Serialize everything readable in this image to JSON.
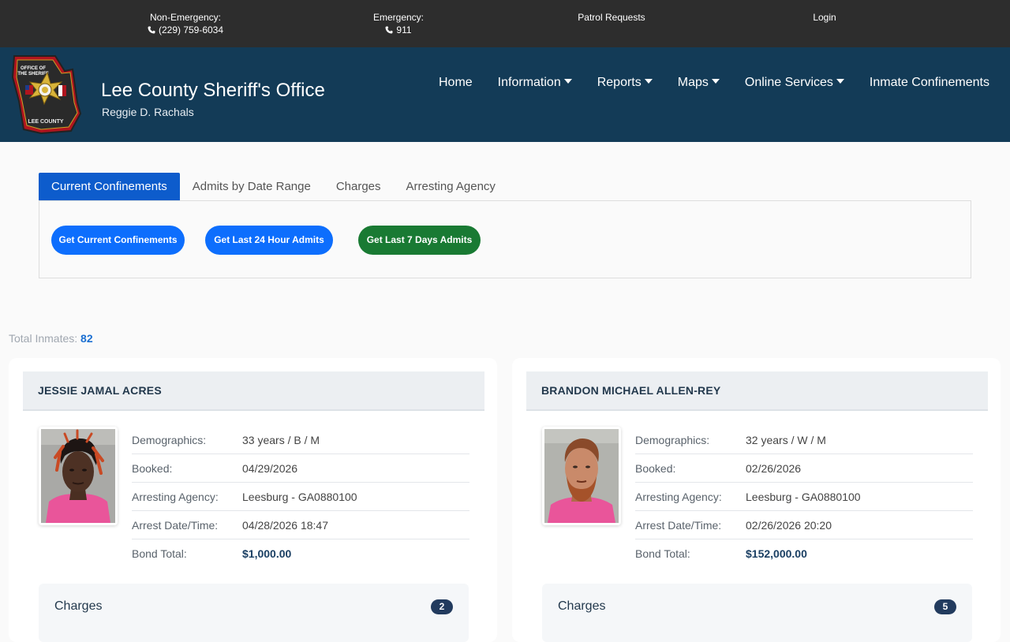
{
  "topbar": {
    "non_emergency_label": "Non-Emergency:",
    "non_emergency_phone": "(229) 759-6034",
    "emergency_label": "Emergency:",
    "emergency_phone": "911",
    "patrol_requests": "Patrol Requests",
    "login": "Login"
  },
  "header": {
    "title": "Lee County Sheriff's Office",
    "subtitle": "Reggie D. Rachals",
    "logo_text_top": "OFFICE OF THE SHERIFF",
    "logo_text_bottom": "LEE COUNTY",
    "logo_badge_text": "SHERIFF LEE COUNTY"
  },
  "nav": {
    "home": "Home",
    "information": "Information",
    "reports": "Reports",
    "maps": "Maps",
    "online_services": "Online Services",
    "inmate_confinements": "Inmate Confinements"
  },
  "tabs": {
    "current_confinements": "Current Confinements",
    "admits_by_date_range": "Admits by Date Range",
    "charges": "Charges",
    "arresting_agency": "Arresting Agency"
  },
  "buttons": {
    "get_current": "Get Current Confinements",
    "get_24h": "Get Last 24 Hour Admits",
    "get_7d": "Get Last 7 Days Admits"
  },
  "total": {
    "label": "Total Inmates:",
    "value": "82"
  },
  "labels": {
    "demographics": "Demographics:",
    "booked": "Booked:",
    "arresting_agency": "Arresting Agency:",
    "arrest_datetime": "Arrest Date/Time:",
    "bond_total": "Bond Total:",
    "charges": "Charges"
  },
  "inmates": [
    {
      "name": "JESSIE JAMAL ACRES",
      "demographics": "33 years / B / M",
      "booked": "04/29/2026",
      "arresting_agency": "Leesburg - GA0880100",
      "arrest_datetime": "04/28/2026 18:47",
      "bond_total": "$1,000.00",
      "charges_count": "2"
    },
    {
      "name": "BRANDON MICHAEL ALLEN-REY",
      "demographics": "32 years / W / M",
      "booked": "02/26/2026",
      "arresting_agency": "Leesburg - GA0880100",
      "arrest_datetime": "02/26/2026 20:20",
      "bond_total": "$152,000.00",
      "charges_count": "5"
    }
  ],
  "colors": {
    "topbar": "#2d2d2d",
    "header": "#133b57",
    "tab_active": "#0d5ccc",
    "button_blue": "#0d6efd",
    "button_green": "#197a33",
    "badge": "#223b5e"
  }
}
